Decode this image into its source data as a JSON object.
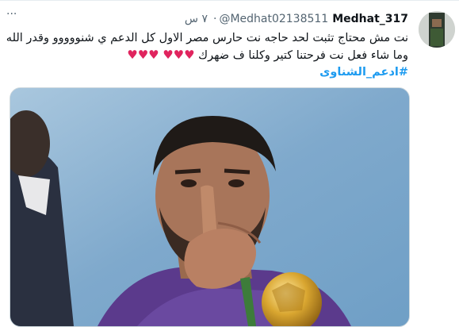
{
  "tweet": {
    "author_name": "Medhat_317",
    "handle": "@Medhat02138511",
    "separator": "·",
    "time": "٧ س",
    "text_line_1": "نت مش محتاج تثبت لحد حاجه نت حارس مصر الاول كل الدعم ي شنووووو وقدر الله",
    "text_line_2": "وما شاء فعل نت فرحتنا كتير وكلنا ف ضهرك",
    "hearts_line_2": "♥♥♥",
    "hearts_line_2_extra": "♥♥♥",
    "hashtag": "#ادعم_الشناوى",
    "more_icon": "···"
  },
  "colors": {
    "hashtag": "#1d9bf0",
    "heart": "#e0245e",
    "text": "#0f1419",
    "muted": "#536471"
  },
  "icons": [
    "more-options-icon",
    "avatar"
  ]
}
